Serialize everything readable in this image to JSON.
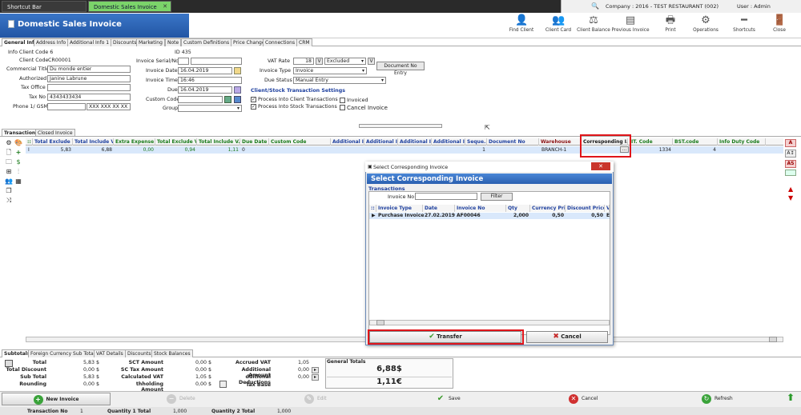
{
  "tabs": [
    {
      "label": "Shortcut Bar"
    },
    {
      "label": "Domestic Sales Invoice"
    }
  ],
  "company": {
    "label": "Company : 2016 - TEST RESTAURANT (002)"
  },
  "user": {
    "label": "User : Admin"
  },
  "page_title": "Domestic Sales Invoice",
  "toolbar": {
    "find_client": "Find Client",
    "client_card": "Client Card",
    "client_balance": "Client Balance",
    "previous_invoice": "Previous Invoice",
    "print": "Print",
    "operations": "Operations",
    "shortcuts": "Shortcuts",
    "close": "Close"
  },
  "subtabs": [
    "General Info",
    "Address Info",
    "Additional Info 1",
    "Discounts",
    "Marketing",
    "Note",
    "Custom Definitions",
    "Price Change",
    "Connections",
    "CRM"
  ],
  "form": {
    "info_client_code": "Info Client Code 6",
    "id": "ID 435",
    "client_code_label": "Client Code",
    "client_code": "CR00001",
    "commercial_title_label": "Commercial Title",
    "commercial_title": "Du monde entier",
    "authorized_label": "Authorized",
    "authorized": "Janine Labrune",
    "tax_office_label": "Tax Office",
    "tax_office": "",
    "tax_no_label": "Tax No",
    "tax_no": "4343433434",
    "phone_label": "Phone 1/ GSM",
    "phone2": "XXX XXX XX XX",
    "invoice_serial_label": "Invoice Serial/No",
    "invoice_date_label": "Invoice Date",
    "invoice_date": "16.04.2019",
    "invoice_time_label": "Invoice Time",
    "invoice_time": "16:46",
    "due_label": "Due",
    "due": "16.04.2019",
    "custom_code_label": "Custom Code",
    "group_label": "Group",
    "vat_rate_label": "VAT Rate",
    "vat_rate": "18",
    "vat_mode": "Excluded",
    "document_no_entry": "Document No Entry",
    "invoice_type_label": "Invoice Type",
    "invoice_type": "Invoice",
    "due_status_label": "Due Status",
    "due_status": "Manual Entry",
    "transaction_settings": "Client/Stock Transaction Settings",
    "process_client": "Process Into Client Transactions",
    "process_stock": "Process Into Stock Transactions",
    "invoiced": "Invoiced",
    "cancel_invoice": "Cancel Invoice",
    "check_mark": "✓"
  },
  "grid_tabs": [
    "Transactions",
    "Closed Invoice"
  ],
  "grid": {
    "headers": [
      "Total Exclude V...",
      "Total Include V...",
      "Extra Expense",
      "Total Exclude V...",
      "Total Include V...",
      "Due Date",
      "Custom Code",
      "Additional I...",
      "Additional I...",
      "Additional I...",
      "Additional I...",
      "Seque...",
      "Document No",
      "Warehouse",
      "Corresponding I...",
      "IT. Code",
      "BST.code",
      "Info Duty Code"
    ],
    "row": [
      "5,83",
      "6,88",
      "0,00",
      "0,94",
      "1,11",
      "0",
      "1",
      "BRANCH-1",
      "1334",
      "4"
    ],
    "row_marker": "I",
    "ellipsis": "..."
  },
  "modal": {
    "title": "Select Corresponding Invoice",
    "banner": "Select Corresponding Invoice",
    "section": "Transactions",
    "invoice_no_label": "Invoice No",
    "invoice_no": "",
    "filter": "Filter",
    "headers": [
      "Invoice Type",
      "Date",
      "Invoice No",
      "Qty",
      "Currency Pri...",
      "Discount Prices",
      "V"
    ],
    "row": [
      "Purchase Invoice",
      "27.02.2019 1",
      "AF00046",
      "2,000",
      "0,50",
      "0,50",
      "E"
    ],
    "transfer": "Transfer",
    "cancel": "Cancel"
  },
  "bottom_tabs": [
    "Subtotals",
    "Foreign Currency Sub Total",
    "VAT Details",
    "Discounts",
    "Stock Balances"
  ],
  "subtotals": {
    "total_label": "Total",
    "total": "5,83 $",
    "total_discount_label": "Total Discount",
    "total_discount": "0,00 $",
    "sub_total_label": "Sub Total",
    "sub_total": "5,83 $",
    "rounding_label": "Rounding",
    "rounding": "0,00 $",
    "sct_amount_label": "SCT Amount",
    "sct_amount": "0,00 $",
    "sc_tax_amount_label": "SC Tax Amount",
    "sc_tax_amount": "0,00 $",
    "calculated_vat_label": "Calculated VAT",
    "calculated_vat": "1,05 $",
    "withholding_label": "thholding Amount",
    "withholding": "0,00 $",
    "accrued_vat_label": "Accrued VAT",
    "accrued_vat": "1,05",
    "additional_amount_label": "Additional Amount",
    "additional_amount": "0,00",
    "additional_deductions_label": "dditional Deductions",
    "additional_deductions": "0,00",
    "tax_base_label": "Tax Base",
    "general_totals_label": "General Totals",
    "general_total_usd": "6,88$",
    "general_total_eur": "1,11€"
  },
  "actions": {
    "new_invoice": "New Invoice",
    "delete": "Delete",
    "edit": "Edit",
    "save": "Save",
    "cancel": "Cancel",
    "refresh": "Refresh"
  },
  "status": {
    "transaction_no_label": "Transaction No",
    "transaction_no": "1",
    "qty1_label": "Quantity 1 Total",
    "qty1": "1,000",
    "qty2_label": "Quantity 2 Total",
    "qty2": "1,000"
  },
  "colors": {
    "banner_blue": "#2255a4",
    "highlight_red": "#e0151a",
    "green_header": "#1a7a1a",
    "active_tab_green": "#7bd46a"
  }
}
